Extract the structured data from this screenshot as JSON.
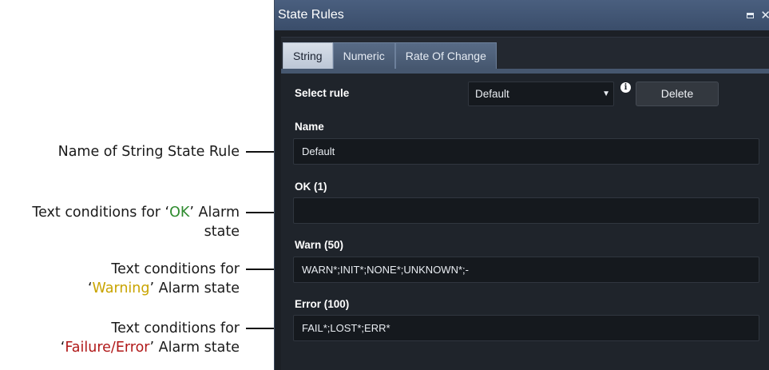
{
  "window": {
    "title": "State Rules",
    "maximize_icon": "maximize-icon",
    "close_icon": "close-icon"
  },
  "tabs": [
    {
      "label": "String",
      "active": true
    },
    {
      "label": "Numeric",
      "active": false
    },
    {
      "label": "Rate Of Change",
      "active": false
    }
  ],
  "form": {
    "select_rule_label": "Select rule",
    "select_rule_value": "Default",
    "info_icon": "info-icon",
    "delete_label": "Delete",
    "name_label": "Name",
    "name_value": "Default",
    "ok_label": "OK (1)",
    "ok_value": "",
    "warn_label": "Warn (50)",
    "warn_value": "WARN*;INIT*;NONE*;UNKNOWN*;-",
    "error_label": "Error (100)",
    "error_value": "FAIL*;LOST*;ERR*"
  },
  "callouts": {
    "name": "Name of String State Rule",
    "ok_line1_pre": "Text conditions for ‘",
    "ok_highlight": "OK",
    "ok_line1_post": "’ Alarm",
    "ok_line2": "state",
    "warn_line1": "Text conditions for",
    "warn_pre": "‘",
    "warn_highlight": "Warning",
    "warn_post": "’ Alarm state",
    "err_line1": "Text conditions for",
    "err_pre": "‘",
    "err_highlight": "Failure/Error",
    "err_post": "’ Alarm state"
  },
  "colors": {
    "ok": "#2e8b2e",
    "warning": "#c9a400",
    "error": "#b01818",
    "titlebar": "#4a5f7f"
  }
}
